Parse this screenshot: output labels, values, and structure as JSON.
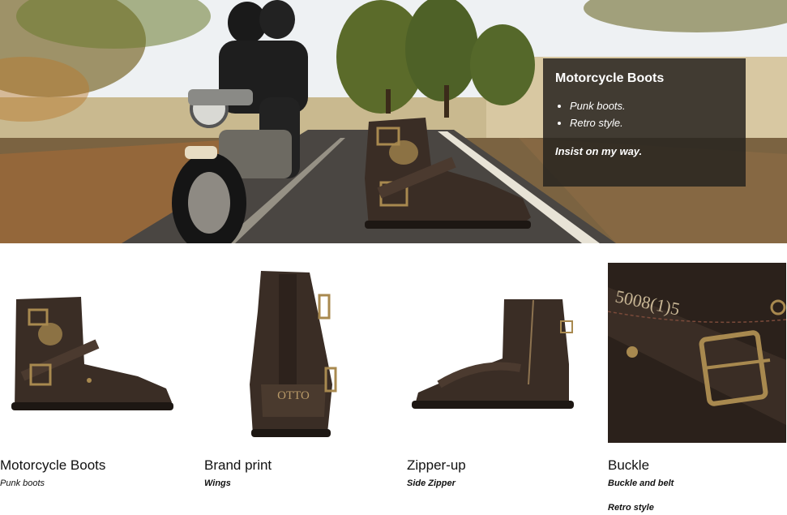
{
  "hero": {
    "panel_title": "Motorcycle Boots",
    "bullets": [
      "Punk boots.",
      "Retro style."
    ],
    "tagline": "Insist on my way."
  },
  "products": [
    {
      "title": "Motorcycle Boots",
      "subtitle": "Punk boots",
      "subtitle_bold": false
    },
    {
      "title": "Brand print",
      "subtitle": "Wings",
      "subtitle_bold": true,
      "emblem": "OTTO"
    },
    {
      "title": "Zipper-up",
      "subtitle": "Side Zipper",
      "subtitle_bold": true
    },
    {
      "title": "Buckle",
      "subtitle": "Buckle and belt",
      "subtitle_bold": true,
      "extra": "Retro style",
      "emblem": "5008(1)5"
    }
  ],
  "colors": {
    "leather": "#3a2d25",
    "sole": "#1d1713",
    "brass": "#a8894f",
    "panel_bg": "#2a2420"
  }
}
